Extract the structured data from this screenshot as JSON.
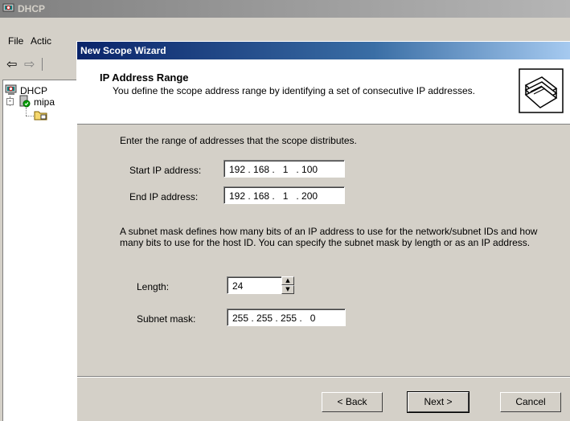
{
  "background_window": {
    "title": "DHCP",
    "menu": [
      "File",
      "Actic"
    ],
    "tree": {
      "root_label": "DHCP",
      "server_label": "mipa"
    }
  },
  "wizard": {
    "title": "New Scope Wizard",
    "header_title": "IP Address Range",
    "header_subtitle": "You define the scope address range by identifying a set of consecutive IP addresses.",
    "range_prompt": "Enter the range of addresses that the scope distributes.",
    "start_label": "Start IP address:",
    "start_value": "192 . 168 .   1   . 100",
    "end_label": "End IP address:",
    "end_value": "192 . 168 .   1   . 200",
    "mask_paragraph": "A subnet mask defines how many bits of an IP address to use for the network/subnet IDs and how many bits to use for the host ID. You can specify the subnet mask by length or as an IP address.",
    "length_label": "Length:",
    "length_value": "24",
    "mask_label": "Subnet mask:",
    "mask_value": "255 . 255 . 255 .   0",
    "buttons": {
      "back": "< Back",
      "next": "Next >",
      "cancel": "Cancel"
    }
  },
  "colors": {
    "title_active": "#0a246a",
    "title_inactive": "#808080",
    "dialog_face": "#d4d0c8"
  }
}
